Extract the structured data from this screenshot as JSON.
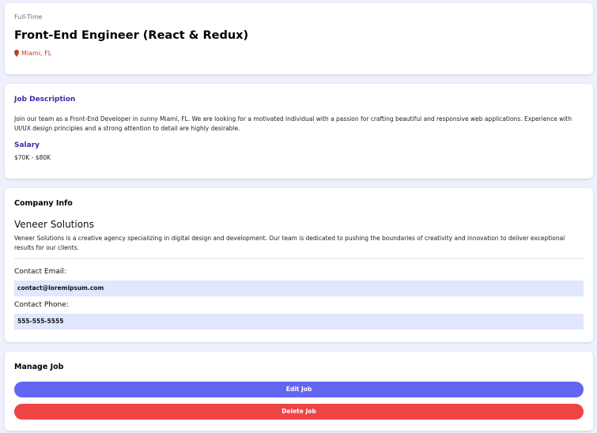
{
  "job": {
    "type": "Full-Time",
    "title": "Front-End Engineer (React & Redux)",
    "location": "Miami, FL"
  },
  "description": {
    "heading": "Job Description",
    "text": "Join our team as a Front-End Developer in sunny Miami, FL. We are looking for a motivated individual with a passion for crafting beautiful and responsive web applications. Experience with UI/UX design principles and a strong attention to detail are highly desirable.",
    "salary_heading": "Salary",
    "salary": "$70K - $80K"
  },
  "company": {
    "heading": "Company Info",
    "name": "Veneer Solutions",
    "description": "Veneer Solutions is a creative agency specializing in digital design and development. Our team is dedicated to pushing the boundaries of creativity and innovation to deliver exceptional results for our clients.",
    "email_label": "Contact Email:",
    "email": "contact@loremipsum.com",
    "phone_label": "Contact Phone:",
    "phone": "555-555-5555"
  },
  "manage": {
    "heading": "Manage Job",
    "edit_label": "Edit Job",
    "delete_label": "Delete Job"
  },
  "colors": {
    "accent_heading": "#3730a3",
    "location": "#c0392b",
    "edit_button": "#6366f1",
    "delete_button": "#ef4444",
    "field_bg": "#e0e7ff"
  },
  "icons": {
    "location": "map-pin-icon"
  }
}
